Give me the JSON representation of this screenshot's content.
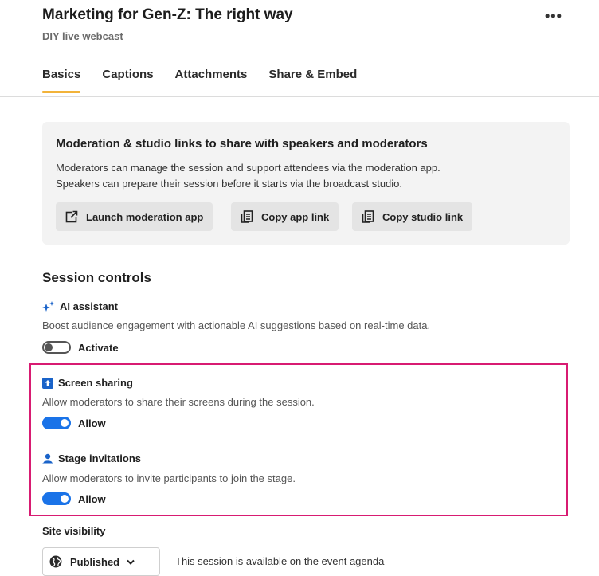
{
  "header": {
    "title": "Marketing for Gen-Z: The right way",
    "subtitle": "DIY live webcast",
    "more_label": "•••"
  },
  "tabs": [
    {
      "label": "Basics",
      "active": true
    },
    {
      "label": "Captions",
      "active": false
    },
    {
      "label": "Attachments",
      "active": false
    },
    {
      "label": "Share & Embed",
      "active": false
    }
  ],
  "moderation_panel": {
    "title": "Moderation & studio links to share with speakers and moderators",
    "desc_line1": "Moderators can manage the session and support attendees via the moderation app.",
    "desc_line2": "Speakers can prepare their session before it starts via the broadcast studio.",
    "buttons": {
      "launch": {
        "label": "Launch moderation app",
        "icon": "external-link-icon"
      },
      "copy_app": {
        "label": "Copy app link",
        "icon": "copy-icon"
      },
      "copy_studio": {
        "label": "Copy studio link",
        "icon": "copy-icon"
      }
    }
  },
  "session_controls": {
    "title": "Session controls",
    "ai_assistant": {
      "title": "AI assistant",
      "icon": "sparkle-icon",
      "desc": "Boost audience engagement with actionable AI suggestions based on real-time data.",
      "toggle_label": "Activate",
      "enabled": false
    },
    "screen_sharing": {
      "title": "Screen sharing",
      "icon": "screen-share-icon",
      "desc": "Allow moderators to share their screens during the session.",
      "toggle_label": "Allow",
      "enabled": true
    },
    "stage_invitations": {
      "title": "Stage invitations",
      "icon": "person-icon",
      "desc": "Allow moderators to invite participants to join the stage.",
      "toggle_label": "Allow",
      "enabled": true
    }
  },
  "site_visibility": {
    "label": "Site visibility",
    "selected": "Published",
    "note": "This session is available on the event agenda"
  },
  "colors": {
    "accent_tab": "#f2b33a",
    "toggle_on": "#1a73e8",
    "highlight": "#d81b72",
    "panel_bg": "#f3f3f3"
  }
}
